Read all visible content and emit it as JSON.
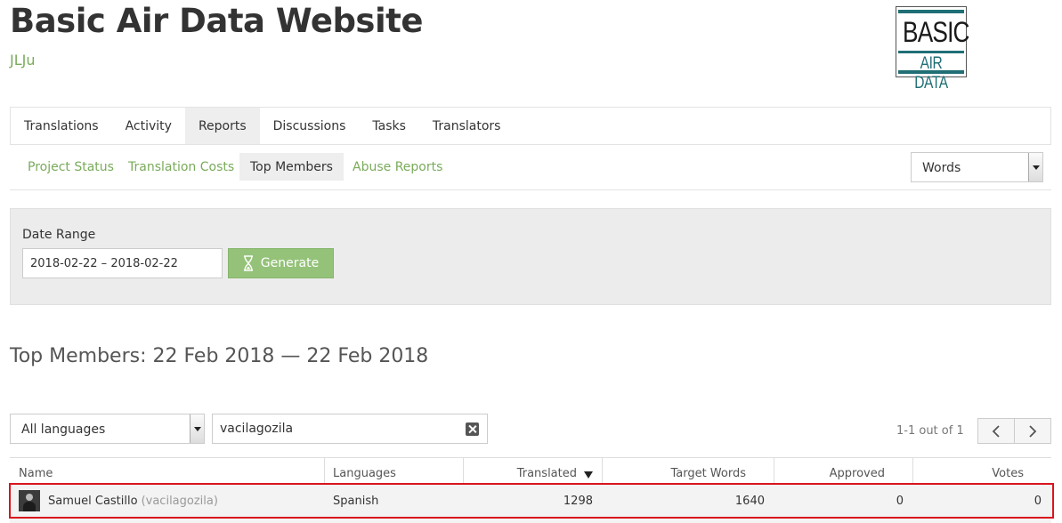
{
  "header": {
    "title": "Basic Air Data Website",
    "subtitle": "JLJu",
    "logo_line1": "BASIC",
    "logo_line2": "AIR DATA"
  },
  "nav": {
    "items": [
      {
        "label": "Translations"
      },
      {
        "label": "Activity"
      },
      {
        "label": "Reports",
        "active": true
      },
      {
        "label": "Discussions"
      },
      {
        "label": "Tasks"
      },
      {
        "label": "Translators"
      }
    ]
  },
  "subnav": {
    "items": [
      {
        "label": "Project Status"
      },
      {
        "label": "Translation Costs"
      },
      {
        "label": "Top Members",
        "active": true
      },
      {
        "label": "Abuse Reports"
      }
    ],
    "unit_select": "Words"
  },
  "filter": {
    "date_range_label": "Date Range",
    "date_range_value": "2018-02-22 – 2018-02-22",
    "generate_label": "Generate"
  },
  "report": {
    "title": "Top Members: 22 Feb 2018 — 22 Feb 2018",
    "language_select": "All languages",
    "search_value": "vacilagozila",
    "page_count": "1-1 out of 1"
  },
  "table": {
    "columns": {
      "name": "Name",
      "languages": "Languages",
      "translated": "Translated",
      "target_words": "Target Words",
      "approved": "Approved",
      "votes": "Votes"
    },
    "sorted_by": "translated",
    "rows": [
      {
        "name": "Samuel Castillo",
        "username": "(vacilagozila)",
        "languages": "Spanish",
        "translated": "1298",
        "target_words": "1640",
        "approved": "0",
        "votes": "0"
      }
    ]
  },
  "colors": {
    "accent_green": "#7aab5b",
    "button_green": "#94c279",
    "highlight_red": "#d9141e",
    "logo_teal": "#1f6f75"
  }
}
